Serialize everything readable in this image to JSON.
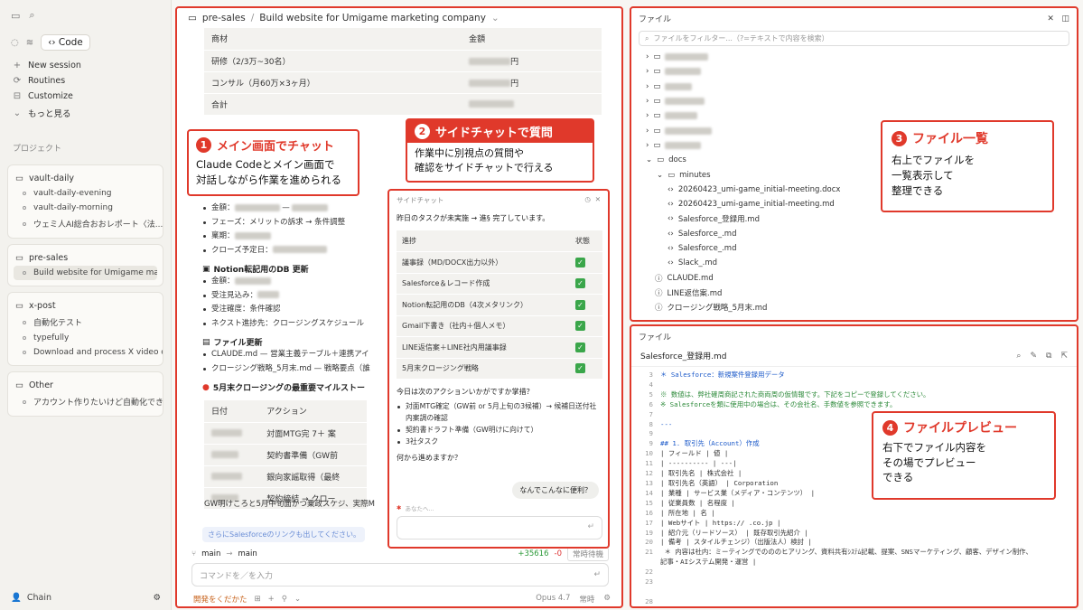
{
  "sidebar": {
    "code_label": "Code",
    "links": [
      {
        "icon": "+",
        "label": "New session"
      },
      {
        "icon": "⟳",
        "label": "Routines"
      },
      {
        "icon": "⊟",
        "label": "Customize"
      },
      {
        "icon": "⌄",
        "label": "もっと見る"
      }
    ],
    "section": "プロジェクト",
    "projects": [
      {
        "name": "vault-daily",
        "items": [
          "vault-daily-evening",
          "vault-daily-morning",
          "ウェミ人AI総合おおレポート〈法..."
        ]
      },
      {
        "name": "pre-sales",
        "items": [
          "Build website for Umigame marketing..."
        ]
      },
      {
        "name": "x-post",
        "items": [
          "自動化テスト",
          "typefully",
          "Download and process X video co..."
        ]
      },
      {
        "name": "Other",
        "items": [
          "アカウント作りたいけど自動化でき..."
        ]
      }
    ],
    "user": "Chain"
  },
  "main": {
    "breadcrumb_project": "pre-sales",
    "breadcrumb_sep": "/",
    "breadcrumb_title": "Build website for Umigame marketing company",
    "table": {
      "headers": [
        "商材",
        "金額"
      ],
      "rows": [
        {
          "item": "研修（2/3万~30名）",
          "unit": "円"
        },
        {
          "item": "コンサル（月60万×3ヶ月）",
          "unit": "円"
        },
        {
          "item": "合計",
          "unit": ""
        }
      ]
    },
    "bullets1": [
      "金額：",
      "フェーズ：メリットの訴求 → 条件調整",
      "稟期：",
      "クローズ予定日："
    ],
    "notion_title": "Notion転記用のDB 更新",
    "bullets2": [
      "金額：",
      "受注見込み：",
      "受注確度：条件確認",
      "ネクスト進捗先：クロージングスケジュール"
    ],
    "file_title": "ファイル更新",
    "bullets3": [
      "CLAUDE.md — 営業主義テーブル＋連携アイ",
      "クロージング戦略_5月末.md — 戦略要点（誰"
    ],
    "mile_title": "5月末クロージングの最重要マイルストー",
    "mile_headers": [
      "日付",
      "アクション"
    ],
    "mile_rows": [
      "対面MTG完 7＋ 案",
      "契約書準備（GW前",
      "銀向家謡取得（最終",
      "契約締結 → クロー"
    ],
    "summary_text": "GW明けころと5月中旬面かつ乗政スケジ、実際M",
    "link_text": "さらにSalesforceのリンクも出してください。",
    "branch_from": "main",
    "branch_arrow": "→",
    "branch_to": "main",
    "diff_add": "+35616",
    "diff_del": "-0",
    "diff_btn": "常時待機",
    "input_placeholder": "コマンドを／を入力",
    "footer_left": "開発をくだかた",
    "model": "Opus 4.7",
    "mode": "常時"
  },
  "callouts": [
    {
      "n": "1",
      "title": "メイン画面でチャット",
      "lines": [
        "Claude Codeとメイン画面で",
        "対話しながら作業を進められる"
      ]
    },
    {
      "n": "2",
      "title": "サイドチャットで質問",
      "lines": [
        "作業中に別視点の質問や",
        "確認をサイドチャットで行える"
      ]
    },
    {
      "n": "3",
      "title": "ファイル一覧",
      "lines": [
        "右上でファイルを",
        "一覧表示して",
        "整理できる"
      ]
    },
    {
      "n": "4",
      "title": "ファイルプレビュー",
      "lines": [
        "右下でファイル内容を",
        "その場でプレビュー",
        "できる"
      ]
    }
  ],
  "side_chat": {
    "title": "サイドチャット",
    "intro": "昨日のタスクが未実施 → 進§ 完了しています。",
    "headers": [
      "進捗",
      "状態"
    ],
    "rows": [
      "議事録（MD/DOCX出力以外）",
      "Salesforce＆レコード作成",
      "Notion転記用のDB（4次メタリンク）",
      "Gmail下書き（社内＋個人メモ）",
      "LINE返信案＋LINE社内用議事録",
      "5月末クロージング戦略"
    ],
    "question": "今日は次のアクションいかがですか掌措？",
    "bullets": [
      "対面MTG確定（GW前 or 5月上旬の3候補）→ 候補日送付社内案調の確認",
      "契約書ドラフト準備（GW明けに向けて）",
      "3社タスク"
    ],
    "ask": "何から進めますか？",
    "user_msg": "なんでこんなに便利？",
    "typing": "あなたへ..."
  },
  "files": {
    "title": "ファイル",
    "filter_placeholder": "ファイルをフィルター...（?=テキストで内容を検索）",
    "docs": "docs",
    "minutes": "minutes",
    "minute_files": [
      "20260423_umi-game_initial-meeting.docx",
      "20260423_umi-game_initial-meeting.md",
      "Salesforce_登録用.md",
      "Salesforce_.md",
      "Salesforce_.md",
      "Slack_.md"
    ],
    "root_files": [
      "CLAUDE.md",
      "LINE返信案.md",
      "クロージング戦略_5月末.md"
    ]
  },
  "preview": {
    "title": "ファイル",
    "filename": "Salesforce_登録用.md",
    "lines": [
      {
        "n": "3",
        "t": "＊ Salesforce：新規案件登録用データ",
        "c": "bl1"
      },
      {
        "n": "4",
        "t": "",
        "c": ""
      },
      {
        "n": "5",
        "t": "※ 数値は、弊社確周商記された商両周の仮情報です。下記をコピーで登録してください。",
        "c": "gr"
      },
      {
        "n": "6",
        "t": "※  Salesforceを類に使用中の場合は、その会社名、手数値を参照できます。",
        "c": "gr"
      },
      {
        "n": "7",
        "t": "",
        "c": ""
      },
      {
        "n": "8",
        "t": "---",
        "c": "bl1"
      },
      {
        "n": "9",
        "t": "",
        "c": ""
      },
      {
        "n": "9",
        "t": "## 1. 取引先（Account）作成",
        "c": "bl1"
      },
      {
        "n": "10",
        "t": "| フィールド | 値 |",
        "c": ""
      },
      {
        "n": "11",
        "t": "| ---------- | ---|",
        "c": ""
      },
      {
        "n": "12",
        "t": "| 取引先名 | 株式会社 |",
        "c": ""
      },
      {
        "n": "13",
        "t": "| 取引先名（英語） | Corporation",
        "c": ""
      },
      {
        "n": "14",
        "t": "| 業種 | サービス業（メディア・コンテンツ） |",
        "c": ""
      },
      {
        "n": "15",
        "t": "| 従業員数 | 名程度 |",
        "c": ""
      },
      {
        "n": "16",
        "t": "| 所在地 | 名 |",
        "c": ""
      },
      {
        "n": "17",
        "t": "| Webサイト | https://          .co.jp |",
        "c": ""
      },
      {
        "n": "19",
        "t": "| 紹介元（リードソース） | 既存取引先紹介 |",
        "c": ""
      },
      {
        "n": "20",
        "t": "| 備考 | スタイルチェンジ）（出版法人）検討 |",
        "c": ""
      },
      {
        "n": "21",
        "t": "  ＊ 内容は社内：ミーティングでのののヒアリング、資料共有ｼｽﾃﾑ記載、提案、SNSマーケティング、顧客、デザイン制作、",
        "c": ""
      },
      {
        "n": "",
        "t": "記事・AIシステム開発・運営 |",
        "c": ""
      },
      {
        "n": "22",
        "t": "",
        "c": ""
      },
      {
        "n": "23",
        "t": "",
        "c": ""
      },
      {
        "n": "",
        "t": "",
        "c": ""
      },
      {
        "n": "28",
        "t": "",
        "c": ""
      }
    ]
  }
}
